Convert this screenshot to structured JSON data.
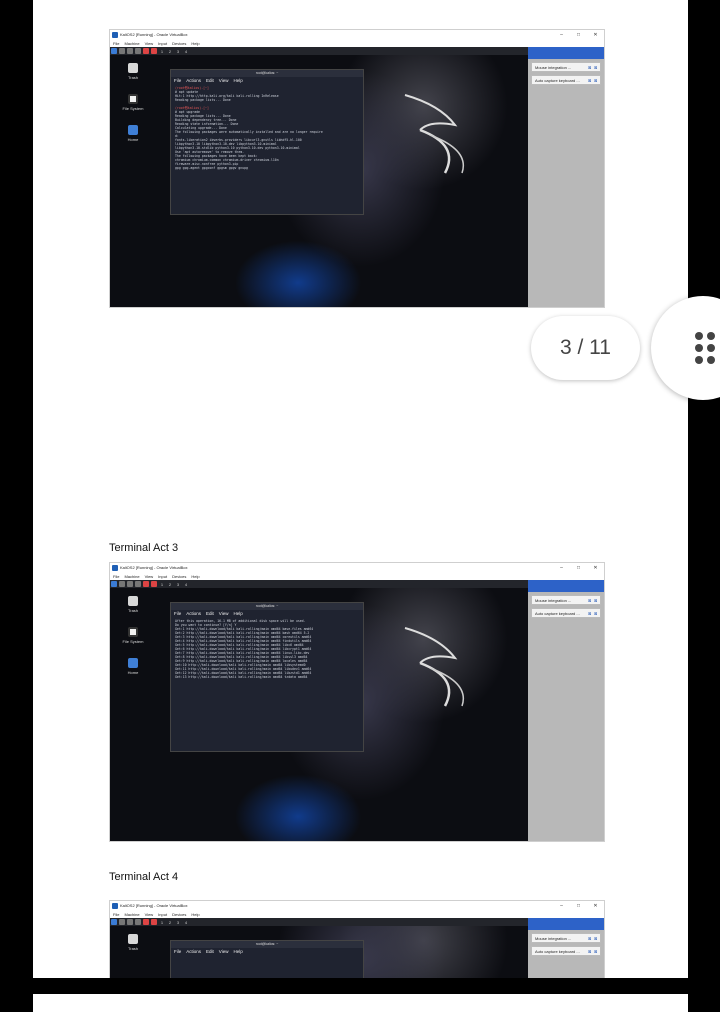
{
  "pager": {
    "text": "3 / 11"
  },
  "captions": [
    "Terminal Act 3",
    "Terminal Act 4"
  ],
  "vbox": {
    "title": "KaliOS2 [Running] - Oracle VirtualBox",
    "menu": [
      "File",
      "Machine",
      "View",
      "Input",
      "Devices",
      "Help"
    ],
    "workspaces": [
      "1",
      "2",
      "3",
      "4"
    ],
    "notifications": [
      "Mouse integration ...",
      "Auto capture keyboard ..."
    ]
  },
  "desktop_icons": [
    "Trash",
    "File System",
    "Home"
  ],
  "terminal": {
    "title": "root@kalios: ~",
    "menu": [
      "File",
      "Actions",
      "Edit",
      "View",
      "Help"
    ]
  },
  "shots": [
    {
      "lines": [
        "(root㉿kalios)-[~]",
        "# apt update",
        "Hit:1 http://http.kali.org/kali kali-rolling InRelease",
        "Reading package lists... Done",
        "",
        "(root㉿kalios)-[~]",
        "# apt upgrade",
        "Reading package lists... Done",
        "Building dependency tree... Done",
        "Reading state information... Done",
        "Calculating upgrade... Done",
        "The following packages were automatically installed and are no longer require",
        "d:",
        "  fonts-liberation2 ibverbs-providers libcurl3-gnutls libhdf5-hl-100",
        "  libpython3.10 libpython3.10-dev libpython3.10-minimal",
        "  libpython3.10-stdlib python3.10 python3.10-dev python3.10-minimal",
        "Use 'apt autoremove' to remove them.",
        "The following packages have been kept back:",
        "  chromium chromium-common chromium-driver chromium-l10n",
        "  firmware-misc-nonfree python3-pip",
        "  gpg gpg-agent gpgconf gpgsm gpgv gnupg"
      ]
    },
    {
      "lines": [
        "After this operation, 16.1 MB of additional disk space will be used.",
        "Do you want to continue? [Y/n] Y",
        "Get:1 http://kali.download/kali kali-rolling/main amd64 base-files amd64",
        "Get:2 http://kali.download/kali kali-rolling/main amd64 bash amd64 5.2",
        "Get:3 http://kali.download/kali kali-rolling/main amd64 coreutils amd64",
        "Get:4 http://kali.download/kali kali-rolling/main amd64 findutils amd64",
        "Get:5 http://kali.download/kali kali-rolling/main amd64 libc6 amd64",
        "Get:6 http://kali.download/kali kali-rolling/main amd64 libcrypt1 amd64",
        "Get:7 http://kali.download/kali kali-rolling/main amd64 linux-libc-dev",
        "Get:8 http://kali.download/kali kali-rolling/main amd64 libssl3 amd64",
        "Get:9 http://kali.download/kali kali-rolling/main amd64 locales amd64",
        "Get:10 http://kali.download/kali kali-rolling/main amd64 libsystemd0",
        "Get:11 http://kali.download/kali kali-rolling/main amd64 libudev1 amd64",
        "Get:12 http://kali.download/kali kali-rolling/main amd64 libzstd1 amd64",
        "Get:13 http://kali.download/kali kali-rolling/main amd64 tzdata amd64"
      ]
    },
    {
      "lines": []
    }
  ]
}
